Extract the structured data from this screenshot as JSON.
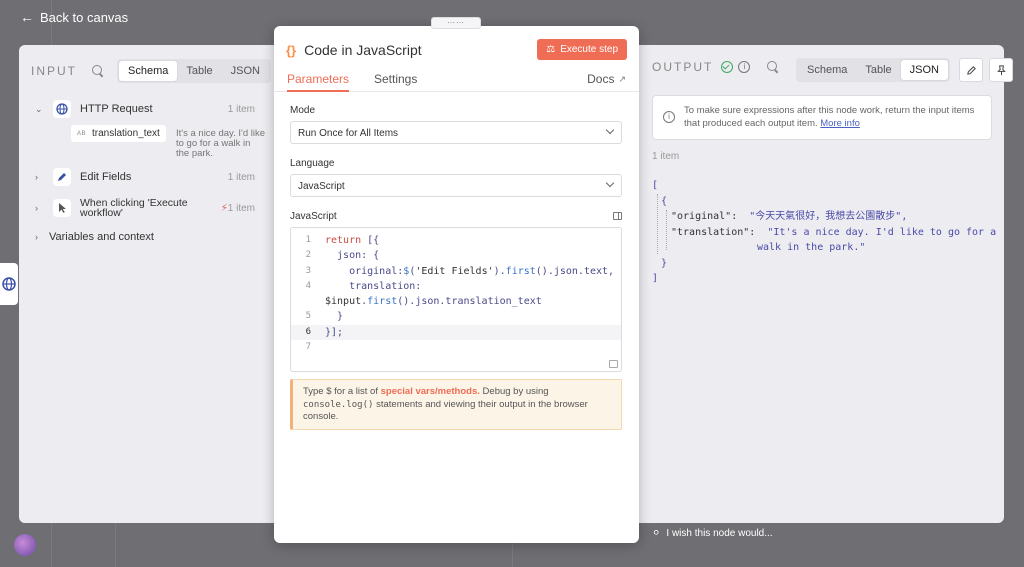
{
  "app": {
    "back_label": "Back to canvas",
    "feedback_label": "I wish this node would..."
  },
  "input": {
    "title": "INPUT",
    "views": [
      "Schema",
      "Table",
      "JSON"
    ],
    "active_view": "Schema",
    "nodes": [
      {
        "name": "HTTP Request",
        "count": "1 item",
        "icon": "globe-icon"
      },
      {
        "name": "Edit Fields",
        "count": "1 item",
        "icon": "pen-icon"
      },
      {
        "name": "When clicking 'Execute workflow'",
        "name_line1": "When clicking 'Execute",
        "name_line2": "workflow'",
        "count": "1 item",
        "icon": "pointer-icon"
      }
    ],
    "field": {
      "type_badge": "AB",
      "name": "translation_text",
      "value": "It's a nice day. I'd like to go for a walk in the park."
    },
    "variables_label": "Variables and context"
  },
  "modal": {
    "title": "Code in JavaScript",
    "execute_label": "Execute step",
    "tabs": [
      "Parameters",
      "Settings"
    ],
    "active_tab": "Parameters",
    "docs_label": "Docs",
    "mode_label": "Mode",
    "mode_value": "Run Once for All Items",
    "language_label": "Language",
    "language_value": "JavaScript",
    "code_label": "JavaScript",
    "code_lines": [
      {
        "n": "1",
        "text": "return [{"
      },
      {
        "n": "2",
        "text": "  json: {"
      },
      {
        "n": "3",
        "text": "    original:$('Edit Fields').first().json.text,"
      },
      {
        "n": "4",
        "text": "    translation:"
      },
      {
        "n": "",
        "text": "$input.first().json.translation_text"
      },
      {
        "n": "5",
        "text": "  }"
      },
      {
        "n": "6",
        "text": "}];"
      },
      {
        "n": "7",
        "text": ""
      }
    ],
    "hint": {
      "prefix": "Type $ for a list of ",
      "link": "special vars/methods.",
      "mid": " Debug by using ",
      "code": "console.log()",
      "suffix": " statements and viewing their output in the browser console."
    }
  },
  "output": {
    "title": "OUTPUT",
    "views": [
      "Schema",
      "Table",
      "JSON"
    ],
    "active_view": "JSON",
    "notice_text": "To make sure expressions after this node work, return the input items that produced each output item.",
    "notice_link": "More info",
    "item_count": "1 item",
    "json": {
      "open_bracket": "[",
      "open_brace": "{",
      "original_key": "\"original\":",
      "original_value": "\"今天天氣很好，我想去公園散步\",",
      "translation_key": "\"translation\":",
      "translation_value_1": "\"It's a nice day. I'd like to go for a",
      "translation_value_2": "walk in the park.\"",
      "close_brace": "}",
      "close_bracket": "]"
    }
  }
}
